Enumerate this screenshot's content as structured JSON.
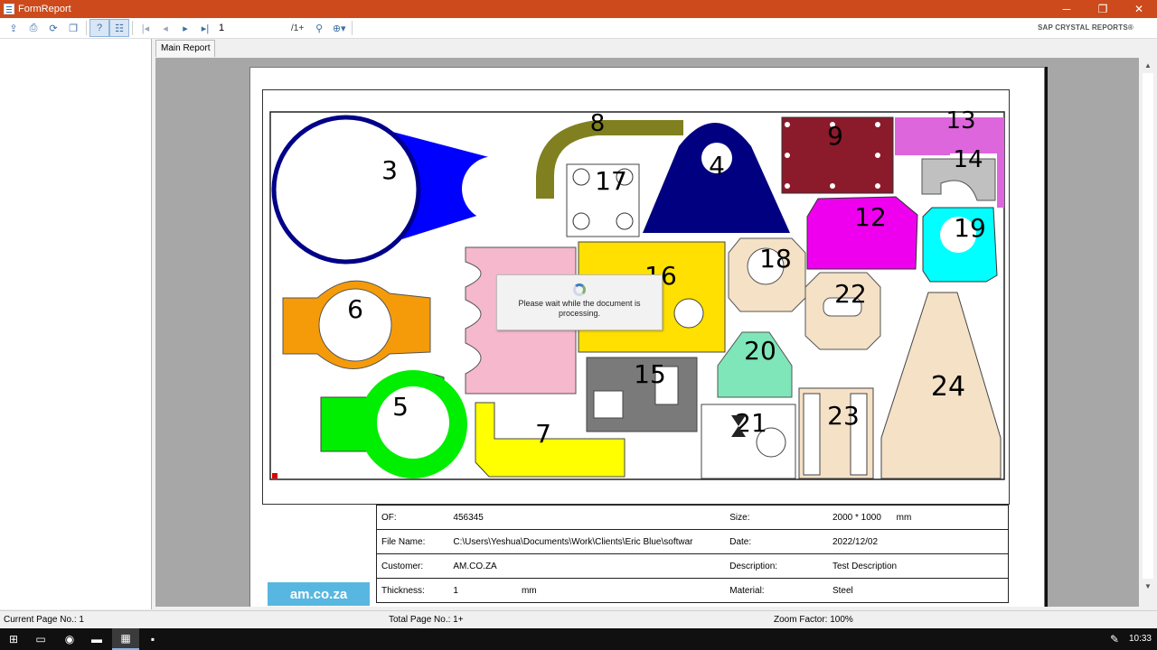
{
  "window": {
    "title": "FormReport",
    "minimize": "─",
    "maximize": "❐",
    "close": "✕"
  },
  "toolbar": {
    "page_value": "1",
    "page_total": "/1+",
    "brand": "SAP CRYSTAL REPORTS®"
  },
  "tabs": [
    {
      "label": "Main Report"
    }
  ],
  "loading": {
    "message": "Please wait while the document is processing."
  },
  "shapes": [
    {
      "label": "3",
      "color": "#0000ff"
    },
    {
      "label": "8",
      "color": "#808020"
    },
    {
      "label": "17",
      "color": "#ffffff"
    },
    {
      "label": "4",
      "color": "#000080"
    },
    {
      "label": "9",
      "color": "#8b1a2a"
    },
    {
      "label": "13",
      "color": "#dd66dd"
    },
    {
      "label": "14",
      "color": "#c0c0c0"
    },
    {
      "label": "12",
      "color": "#ee00ee"
    },
    {
      "label": "19",
      "color": "#00ffff"
    },
    {
      "label": "6",
      "color": "#f59b0a"
    },
    {
      "label": "16",
      "color": "#ffe000"
    },
    {
      "label": "18",
      "color": "#f5e1c6"
    },
    {
      "label": "22",
      "color": "#f5e1c6"
    },
    {
      "label": "20",
      "color": "#7ee6b8"
    },
    {
      "label": "15",
      "color": "#7a7a7a"
    },
    {
      "label": "5",
      "color": "#00ee00"
    },
    {
      "label": "7",
      "color": "#ffff00"
    },
    {
      "label": "21",
      "color": "#ffffff"
    },
    {
      "label": "23",
      "color": "#f5e1c6"
    },
    {
      "label": "24",
      "color": "#f5e1c6"
    }
  ],
  "details": {
    "rows": [
      {
        "l1": "OF:",
        "v1": "456345",
        "l2": "Size:",
        "v2": "2000 * 1000",
        "u2": "mm"
      },
      {
        "l1": "File Name:",
        "v1": "C:\\Users\\Yeshua\\Documents\\Work\\Clients\\Eric Blue\\softwar",
        "l2": "Date:",
        "v2": "2022/12/02"
      },
      {
        "l1": "Customer:",
        "v1": "AM.CO.ZA",
        "l2": "Description:",
        "v2": "Test Description"
      },
      {
        "l1": "Thickness:",
        "v1": "1",
        "u1": "mm",
        "l2": "Material:",
        "v2": "Steel"
      }
    ],
    "logo": "am.co.za"
  },
  "status": {
    "current_page": "Current Page No.: 1",
    "total_page": "Total Page No.: 1+",
    "zoom": "Zoom Factor: 100%"
  },
  "taskbar": {
    "time": "10:33"
  }
}
